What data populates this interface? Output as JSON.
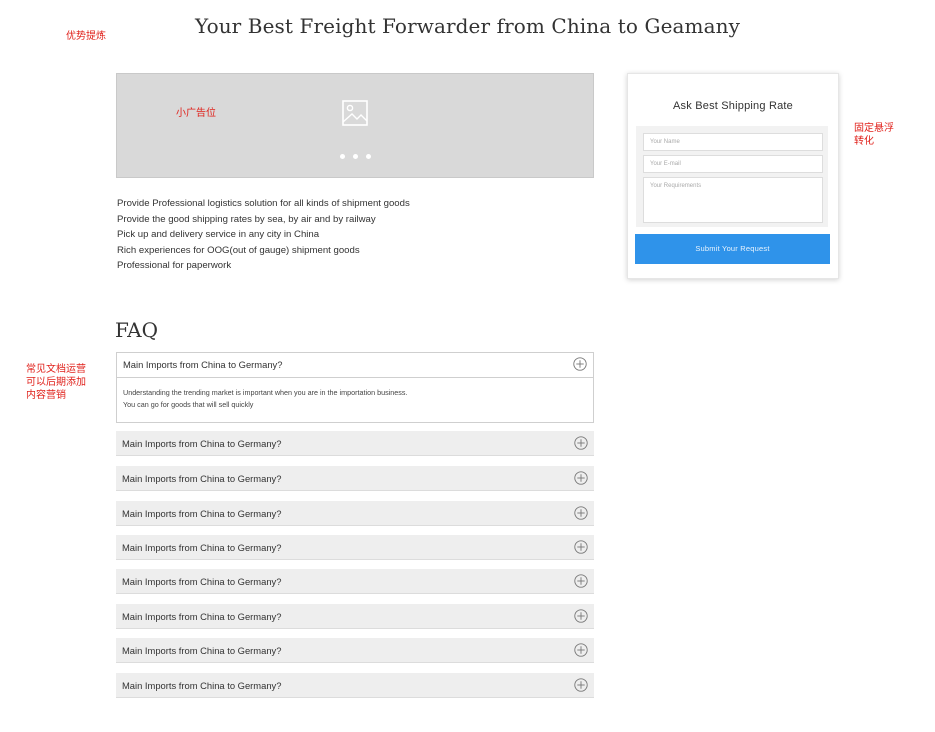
{
  "page_title": "Your Best Freight Forwarder from China to Geamany",
  "notes": {
    "advantages": "优势提炼",
    "small_ad": "小广告位",
    "floating_form": "固定悬浮\n转化",
    "faq_note": "常见文档运营\n可以后期添加\n内容营销"
  },
  "banner": {
    "image_icon": "image-placeholder-icon",
    "dots": 3
  },
  "bullets": [
    "Provide Professional logistics solution for all kinds of shipment goods",
    "Provide the good shipping rates by sea, by air and by railway",
    "Pick up and delivery service in any city in China",
    "Rich experiences for OOG(out of gauge) shipment goods",
    "Professional for paperwork"
  ],
  "faq": {
    "heading": "FAQ",
    "open_item": {
      "question": "Main Imports from China to Germany?",
      "answer_line1": "Understanding the trending market is important when you are in the importation business.",
      "answer_line2": "You can go for goods that will sell quickly"
    },
    "items": [
      "Main Imports from China to Germany?",
      "Main Imports from China to Germany?",
      "Main Imports from China to Germany?",
      "Main Imports from China to Germany?",
      "Main Imports from China to Germany?",
      "Main Imports from China to Germany?",
      "Main Imports from China to Germany?",
      "Main Imports from China to Germany?"
    ],
    "toggle_icon": "plus-circle-icon"
  },
  "form": {
    "title": "Ask Best Shipping Rate",
    "name_placeholder": "Your Name",
    "email_placeholder": "Your E-mail",
    "requirements_placeholder": "Your Requirements",
    "submit_label": "Submit Your Request"
  },
  "colors": {
    "note_red": "#e0211b",
    "submit_blue": "#2f93ea",
    "banner_gray": "#d9d9d9",
    "faq_bg": "#eeeeee"
  }
}
